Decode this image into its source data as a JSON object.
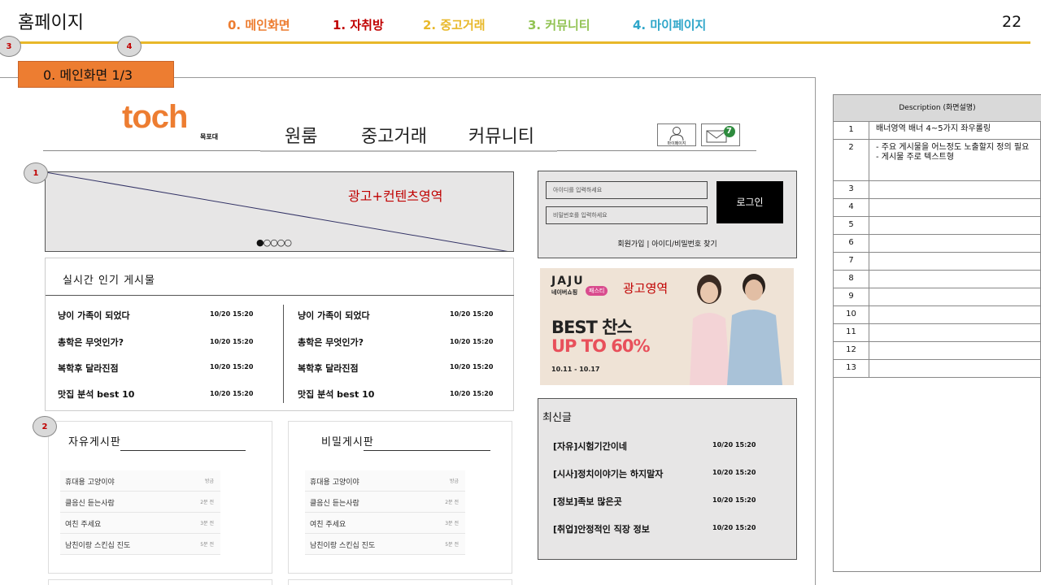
{
  "header": {
    "title": "홈페이지",
    "page_number": "22",
    "tabs": [
      {
        "label": "0. 메인화면",
        "color": "#ed7d31"
      },
      {
        "label": "1. 자취방",
        "color": "#c00000"
      },
      {
        "label": "2. 중고거래",
        "color": "#e8b829"
      },
      {
        "label": "3. 커뮤니티",
        "color": "#92c353"
      },
      {
        "label": "4. 마이페이지",
        "color": "#2ea6c9"
      }
    ],
    "markers": [
      "3",
      "4"
    ],
    "accent": "#e8b829"
  },
  "section": {
    "label": "0. 메인화면 1/3",
    "color": "#ed7d31"
  },
  "site": {
    "logo": "toch",
    "logo_sub": "목포대",
    "nav": [
      "원룸",
      "중고거래",
      "커뮤니티"
    ],
    "mypage_label": "마이페이지",
    "mail_badge": "7"
  },
  "banner": {
    "text": "광고+컨텐츠영역",
    "marker": "1",
    "dots": "●○○○○"
  },
  "login": {
    "id_placeholder": "아이디를 입력하세요",
    "pw_placeholder": "비밀번호를 입력하세요",
    "button": "로그인",
    "links": "회원가입 | 아이디/비밀번호 찾기"
  },
  "popular": {
    "title": "실시간 인기 게시물",
    "left": [
      {
        "title": "냥이 가족이 되었다",
        "time": "10/20 15:20"
      },
      {
        "title": "총학은 무엇인가?",
        "time": "10/20 15:20"
      },
      {
        "title": "복학후 달라진점",
        "time": "10/20 15:20"
      },
      {
        "title": "맛집 분석 best 10",
        "time": "10/20 15:20"
      }
    ],
    "right": [
      {
        "title": "냥이 가족이 되었다",
        "time": "10/20 15:20"
      },
      {
        "title": "총학은 무엇인가?",
        "time": "10/20 15:20"
      },
      {
        "title": "복학후 달라진점",
        "time": "10/20 15:20"
      },
      {
        "title": "맛집 분석 best 10",
        "time": "10/20 15:20"
      }
    ]
  },
  "ad": {
    "brand": "JAJU",
    "brand_sub": "네이버쇼핑",
    "brand_badge": "패스티",
    "label": "광고영역",
    "line1": "BEST 찬스",
    "line2": "UP TO 60%",
    "dates": "10.11 - 10.17"
  },
  "recent": {
    "title": "최신글",
    "items": [
      {
        "title": "[자유]시험기간이네",
        "time": "10/20 15:20"
      },
      {
        "title": "[시사]정치이야기는 하지말자",
        "time": "10/20 15:20"
      },
      {
        "title": "[정보]족보 많은곳",
        "time": "10/20 15:20"
      },
      {
        "title": "[취업]안정적인 직장 정보",
        "time": "10/20 15:20"
      }
    ]
  },
  "boards": {
    "marker": "2",
    "free": {
      "title": "자유게시판",
      "items": [
        {
          "title": "휴대용 고양이야",
          "meta": "방금"
        },
        {
          "title": "클음신 듣는사람",
          "meta": "2분 전"
        },
        {
          "title": "여친 주세요",
          "meta": "3분 전"
        },
        {
          "title": "남친이랑 스킨십 진도",
          "meta": "5분 전"
        }
      ]
    },
    "secret": {
      "title": "비밀게시판",
      "items": [
        {
          "title": "휴대용 고양이야",
          "meta": "방금"
        },
        {
          "title": "클음신 듣는사람",
          "meta": "2분 전"
        },
        {
          "title": "여친 주세요",
          "meta": "3분 전"
        },
        {
          "title": "남친이랑 스킨십 진도",
          "meta": "5분 전"
        }
      ]
    }
  },
  "description": {
    "header": "Description (화면설명)",
    "rows": [
      {
        "n": "1",
        "text": "배너영역 배너 4~5가지 좌우롤링"
      },
      {
        "n": "2",
        "text": "- 주요 게시물을 어느정도 노출할지 정의 필요\n- 게시물 주로 텍스트형"
      },
      {
        "n": "3",
        "text": ""
      },
      {
        "n": "4",
        "text": ""
      },
      {
        "n": "5",
        "text": ""
      },
      {
        "n": "6",
        "text": ""
      },
      {
        "n": "7",
        "text": ""
      },
      {
        "n": "8",
        "text": ""
      },
      {
        "n": "9",
        "text": ""
      },
      {
        "n": "10",
        "text": ""
      },
      {
        "n": "11",
        "text": ""
      },
      {
        "n": "12",
        "text": ""
      },
      {
        "n": "13",
        "text": ""
      }
    ]
  }
}
